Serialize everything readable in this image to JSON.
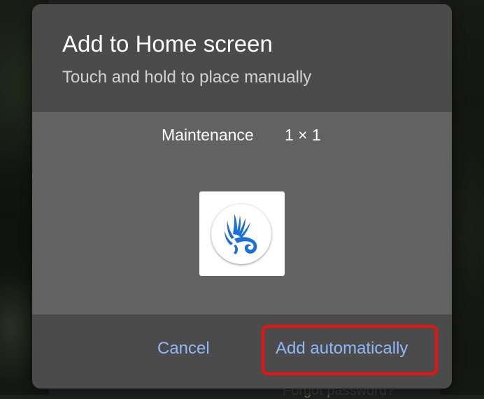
{
  "background": {
    "partial_link_text": "Forgot password?"
  },
  "dialog": {
    "title": "Add to Home screen",
    "subtitle": "Touch and hold to place manually",
    "widget": {
      "name": "Maintenance",
      "size": "1 × 1",
      "icon": "blue-swirl-logo-icon"
    },
    "buttons": {
      "cancel": "Cancel",
      "add": "Add automatically"
    }
  },
  "colors": {
    "accent_button_text": "#90b8f8",
    "highlight_outline": "#ee1111",
    "logo_blue": "#1a6fd8"
  }
}
